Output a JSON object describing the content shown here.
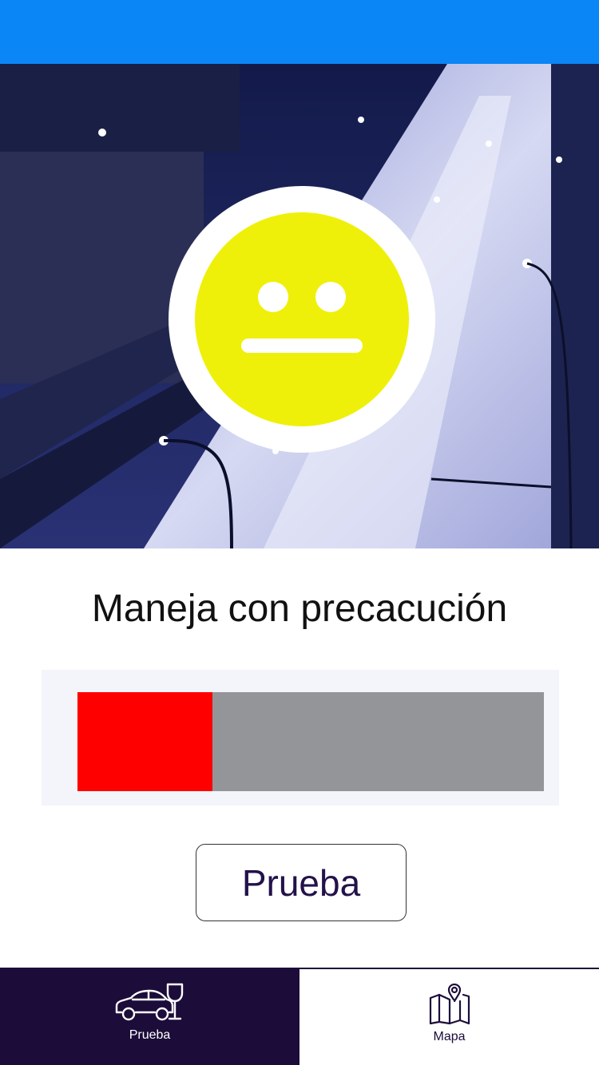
{
  "status": {
    "message": "Maneja con precacución",
    "face_icon": "neutral-face-icon",
    "level_fraction": 0.29
  },
  "actions": {
    "test_button_label": "Prueba"
  },
  "tabbar": {
    "tabs": [
      {
        "label": "Prueba",
        "icon": "car-drink-icon",
        "active": true
      },
      {
        "label": "Mapa",
        "icon": "map-pin-icon",
        "active": false
      }
    ]
  },
  "colors": {
    "topbar": "#0a86f7",
    "face": "#eff00a",
    "meter_fill": "#ff0000",
    "meter_track": "#939599",
    "tab_active_bg": "#1c0c3a"
  }
}
